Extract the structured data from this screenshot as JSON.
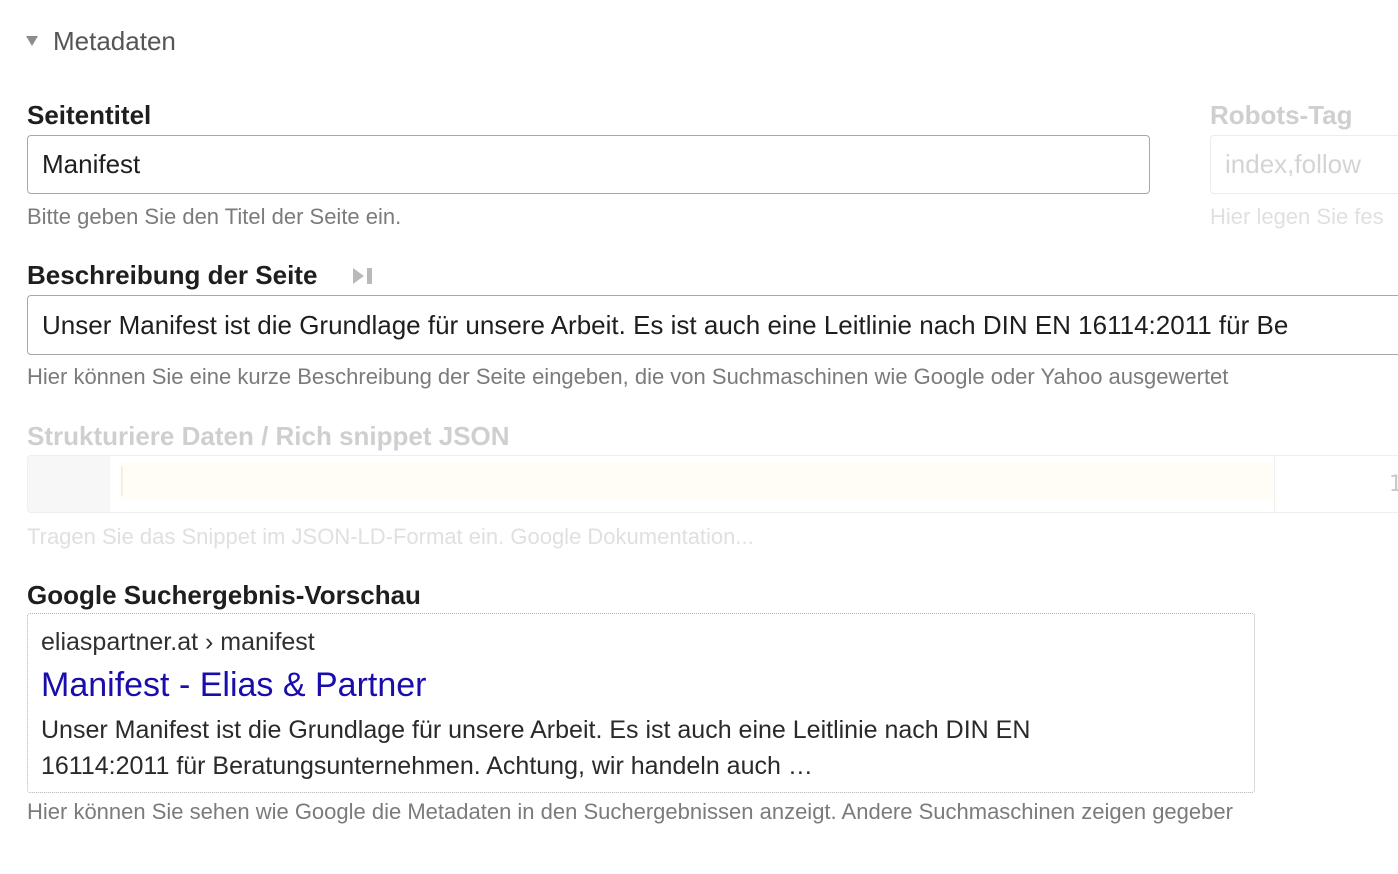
{
  "section": {
    "title": "Metadaten"
  },
  "page_title_field": {
    "label": "Seitentitel",
    "value": "Manifest",
    "help": "Bitte geben Sie den Titel der Seite ein."
  },
  "robots_field": {
    "label": "Robots-Tag",
    "placeholder": "index,follow",
    "help": "Hier legen Sie fes"
  },
  "description_field": {
    "label": "Beschreibung der Seite",
    "value": "Unser Manifest ist die Grundlage für unsere Arbeit. Es ist auch eine Leitlinie nach DIN EN 16114:2011 für Be",
    "help": "Hier können Sie eine kurze Beschreibung der Seite eingeben, die von Suchmaschinen wie Google oder Yahoo ausgewertet"
  },
  "structured_data_field": {
    "label": "Strukturiere Daten / Rich snippet JSON",
    "line_number": "1",
    "help": "Tragen Sie das Snippet im JSON-LD-Format ein. Google Dokumentation..."
  },
  "preview": {
    "label": "Google Suchergebnis-Vorschau",
    "url": "eliaspartner.at › manifest",
    "title": "Manifest - Elias & Partner",
    "description_line1": "Unser Manifest ist die Grundlage für unsere Arbeit. Es ist auch eine Leitlinie nach DIN EN",
    "description_line2": "16114:2011 für Beratungsunternehmen. Achtung, wir handeln auch …",
    "help": "Hier können Sie sehen wie Google die Metadaten in den Suchergebnissen anzeigt. Andere Suchmaschinen zeigen gegeber"
  },
  "icons": {
    "section_toggle": "triangle-down-icon",
    "snippet_copy": "play-end-icon"
  },
  "colors": {
    "link": "#1a0dab",
    "label": "#1e1e1e",
    "help": "#7b7b7b",
    "disabled": "#cfcfcf"
  }
}
